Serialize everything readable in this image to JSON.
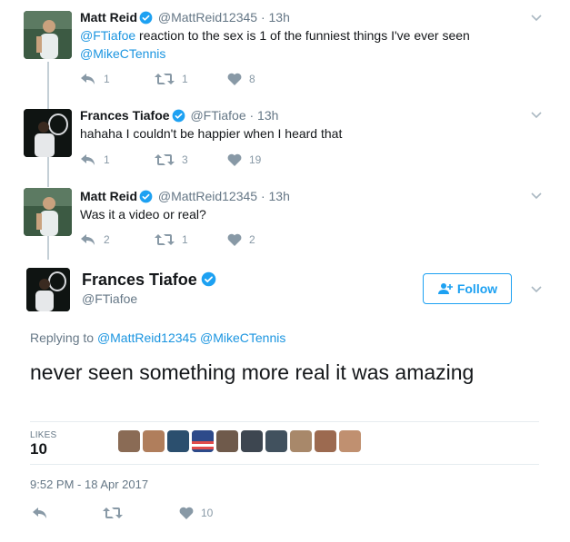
{
  "thread": [
    {
      "name": "Matt Reid",
      "handle": "@MattReid12345",
      "time": "· 13h",
      "text_parts": {
        "mention1": "@FTiafoe",
        "body": " reaction to the sex is 1 of the funniest things I've ever seen",
        "mention2": "@MikeCTennis"
      },
      "replies": "1",
      "retweets": "1",
      "likes": "8"
    },
    {
      "name": "Frances Tiafoe",
      "handle": "@FTiafoe",
      "time": "· 13h",
      "text": "hahaha I couldn't be happier when I heard that",
      "replies": "1",
      "retweets": "3",
      "likes": "19"
    },
    {
      "name": "Matt Reid",
      "handle": "@MattReid12345",
      "time": "· 13h",
      "text": "Was it a video or real?",
      "replies": "2",
      "retweets": "1",
      "likes": "2"
    }
  ],
  "main": {
    "name": "Frances Tiafoe",
    "handle": "@FTiafoe",
    "follow_label": "Follow",
    "replying_prefix": "Replying to",
    "replying_to": "@MattReid12345 @MikeCTennis",
    "text": "never seen something more real it was amazing",
    "likes_label": "LIKES",
    "likes_count": "10",
    "timestamp": "9:52 PM - 18 Apr 2017",
    "like_action_count": "10"
  },
  "icons": {
    "verified": "verified-badge-icon",
    "reply": "reply-icon",
    "retweet": "retweet-icon",
    "like": "heart-icon",
    "more": "chevron-down-icon",
    "follow": "add-user-icon"
  },
  "colors": {
    "link": "#1b95e0",
    "accent": "#1da1f2",
    "muted": "#657786",
    "icon": "#8899a6",
    "thread_line": "#c4cfd6"
  }
}
